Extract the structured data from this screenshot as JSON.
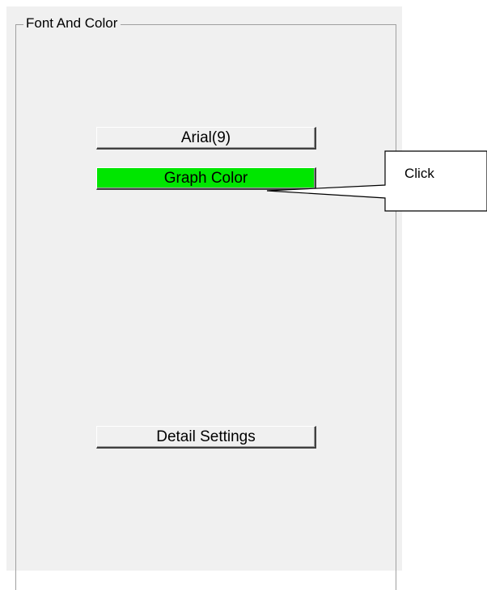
{
  "group": {
    "title": "Font And Color"
  },
  "buttons": {
    "font_label": "Arial(9)",
    "graph_color_label": "Graph Color",
    "detail_settings_label": "Detail Settings"
  },
  "colors": {
    "graph_color_swatch": "#00e600",
    "panel_background": "#f0f0f0"
  },
  "callout": {
    "text": "Click"
  }
}
